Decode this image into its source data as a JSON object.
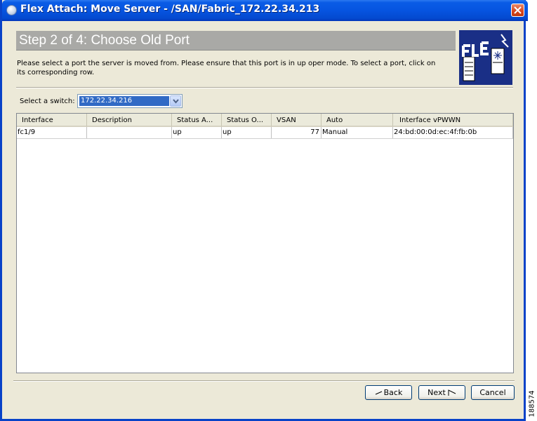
{
  "window": {
    "title": "Flex Attach:  Move Server - /SAN/Fabric_172.22.34.213",
    "icon": "app-globe-icon"
  },
  "step": {
    "title": "Step 2 of 4:  Choose Old Port",
    "instructions": "Please select a port the server is moved from.  Please ensure that this port is in up oper mode.  To select a port, click on its corresponding row."
  },
  "switch_select": {
    "label": "Select a switch:",
    "value": "172.22.34.216"
  },
  "table": {
    "columns": [
      "Interface",
      "Description",
      "Status A...",
      "Status O...",
      "VSAN",
      "Auto",
      "Interface vPWWN"
    ],
    "rows": [
      {
        "interface": "fc1/9",
        "description": "",
        "status_admin": "up",
        "status_oper": "up",
        "vsan": "77",
        "auto": "Manual",
        "vpwwn": "24:bd:00:0d:ec:4f:fb:0b"
      }
    ]
  },
  "buttons": {
    "back": "Back",
    "next": "Next",
    "cancel": "Cancel"
  },
  "figure_id": "188574",
  "colors": {
    "titlebar": "#0654e0",
    "header_bg": "#a9a9a6",
    "logo_bg": "#1a2f86",
    "selection": "#316ac5",
    "dialog_bg": "#ece9d8"
  }
}
